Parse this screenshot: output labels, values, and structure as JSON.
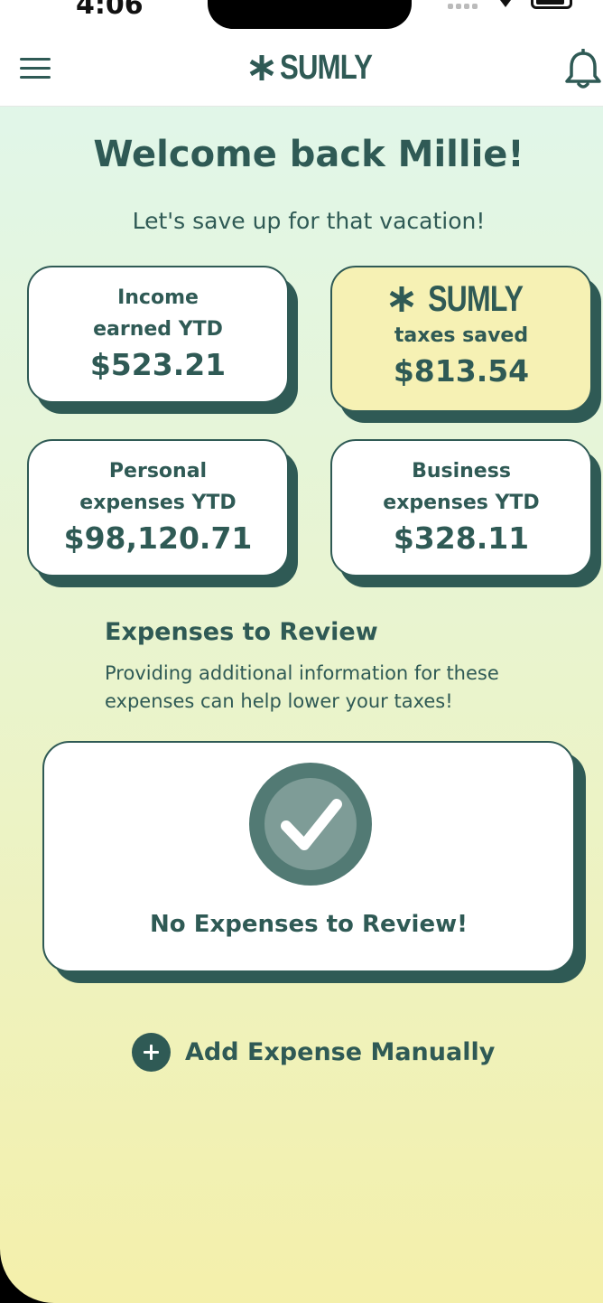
{
  "status_bar": {
    "time": "4:06"
  },
  "header": {
    "brand": "SUMLY"
  },
  "welcome": {
    "title": "Welcome back Millie!",
    "subtitle": "Let's save up for that vacation!"
  },
  "cards": {
    "income": {
      "label_line1": "Income",
      "label_line2": "earned YTD",
      "value": "$523.21"
    },
    "taxes_saved": {
      "brand": "SUMLY",
      "label": "taxes saved",
      "value": "$813.54"
    },
    "personal": {
      "label_line1": "Personal",
      "label_line2": "expenses YTD",
      "value": "$98,120.71"
    },
    "business": {
      "label_line1": "Business",
      "label_line2": "expenses YTD",
      "value": "$328.11"
    }
  },
  "review": {
    "title": "Expenses to Review",
    "description": "Providing additional information for these expenses can help lower your taxes!",
    "empty_message": "No Expenses to Review!"
  },
  "actions": {
    "add_expense_label": "Add Expense Manually"
  },
  "colors": {
    "primary": "#2f5a55",
    "highlight_card": "#f6f1b4",
    "gradient_top": "#dff7ee",
    "gradient_bottom": "#f4f0ab"
  },
  "icons": {
    "menu": "hamburger-icon",
    "notifications": "bell-icon",
    "logo": "asterisk-logo-icon",
    "success": "check-circle-icon",
    "add": "plus-circle-icon"
  }
}
